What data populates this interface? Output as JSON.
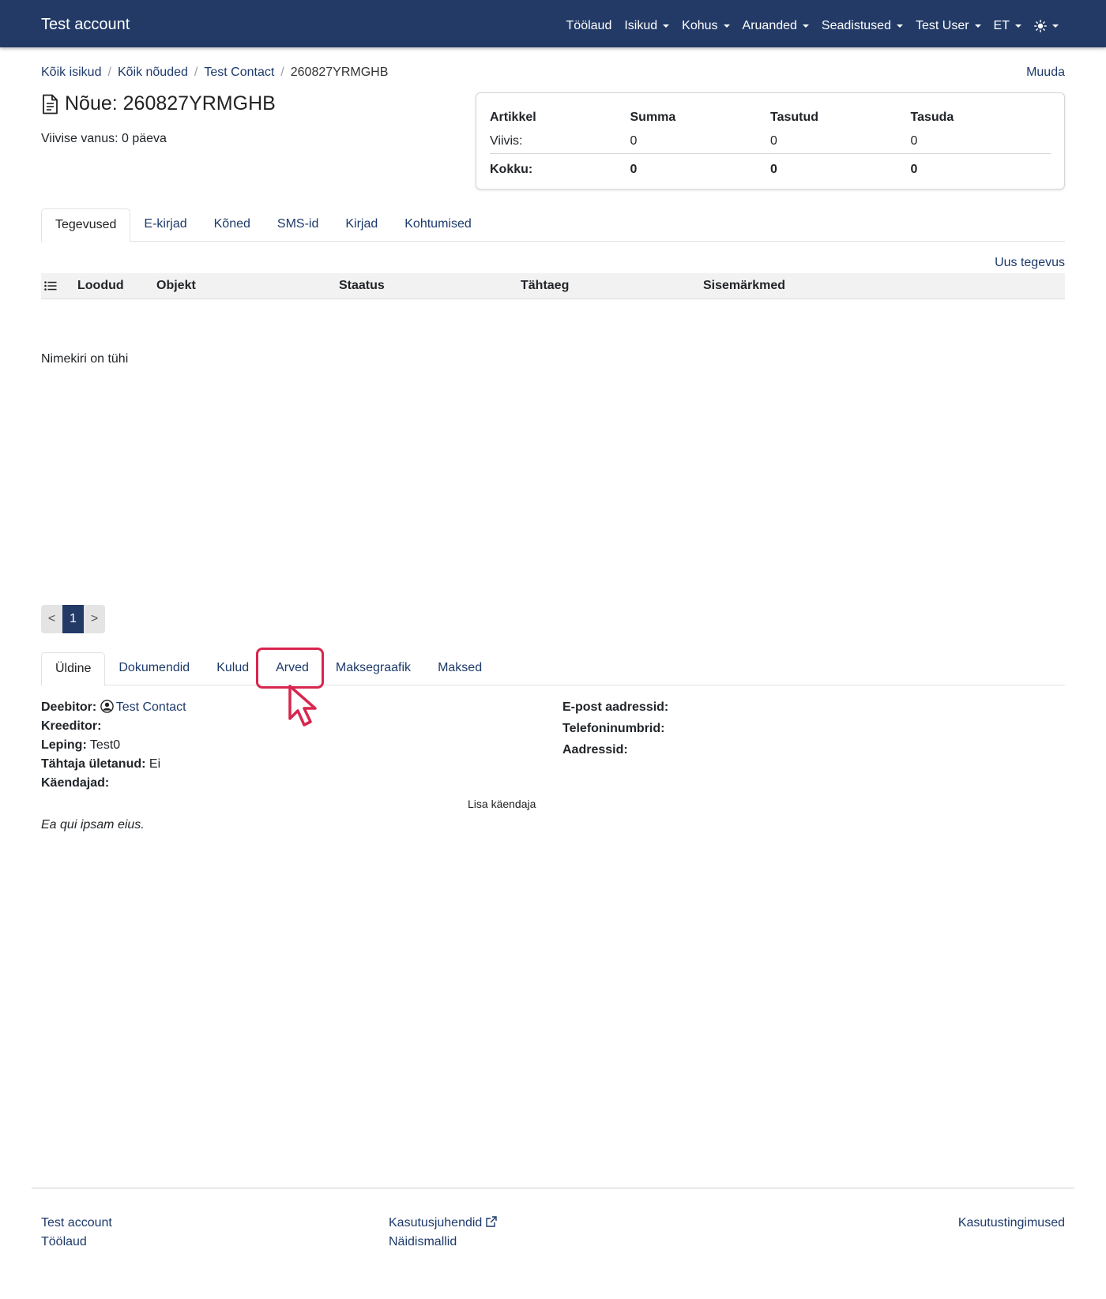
{
  "navbar": {
    "brand": "Test account",
    "items": [
      {
        "label": "Töölaud",
        "dropdown": false
      },
      {
        "label": "Isikud",
        "dropdown": true
      },
      {
        "label": "Kohus",
        "dropdown": true
      },
      {
        "label": "Aruanded",
        "dropdown": true
      },
      {
        "label": "Seadistused",
        "dropdown": true
      },
      {
        "label": "Test User",
        "dropdown": true
      },
      {
        "label": "ET",
        "dropdown": true
      }
    ],
    "theme_icon": "sun-icon",
    "bg_color": "#233a66"
  },
  "breadcrumb": [
    "Kõik isikud",
    "Kõik nõuded",
    "Test Contact",
    "260827YRMGHB"
  ],
  "edit_label": "Muuda",
  "page": {
    "title": "Nõue: 260827YRMGHB",
    "title_icon": "document-icon",
    "age": "Viivise vanus: 0 päeva"
  },
  "summary": {
    "headers": [
      "Artikkel",
      "Summa",
      "Tasutud",
      "Tasuda"
    ],
    "rows": [
      [
        "Viivis:",
        "0",
        "0",
        "0"
      ]
    ],
    "total": [
      "Kokku:",
      "0",
      "0",
      "0"
    ]
  },
  "tabs_top": [
    "Tegevused",
    "E-kirjad",
    "Kõned",
    "SMS-id",
    "Kirjad",
    "Kohtumised"
  ],
  "new_action_label": "Uus tegevus",
  "table": {
    "columns": [
      "Loodud",
      "Objekt",
      "Staatus",
      "Tähtaeg",
      "Sisemärkmed"
    ],
    "empty_text": "Nimekiri on tühi"
  },
  "pagination": {
    "prev": "<",
    "current": "1",
    "next": ">"
  },
  "tabs_bottom": [
    "Üldine",
    "Dokumendid",
    "Kulud",
    "Arved",
    "Maksegraafik",
    "Maksed"
  ],
  "details": {
    "debtor_label": "Deebitor:",
    "debtor_value": "Test Contact",
    "creditor_label": "Kreeditor:",
    "contract_label": "Leping:",
    "contract_value": "Test0",
    "overdue_label": "Tähtaja ületanud:",
    "overdue_value": "Ei",
    "guarantors_label": "Käendajad:",
    "add_guarantor": "Lisa käendaja",
    "note": "Ea qui ipsam eius."
  },
  "contact_info": {
    "emails_label": "E-post aadressid:",
    "phones_label": "Telefoninumbrid:",
    "addresses_label": "Aadressid:"
  },
  "footer": {
    "col1": [
      "Test account",
      "Töölaud"
    ],
    "col2": [
      "Kasutusjuhendid",
      "Näidismallid"
    ],
    "col3": [
      "Kasutustingimused"
    ]
  },
  "highlight_color": "#d8264e"
}
